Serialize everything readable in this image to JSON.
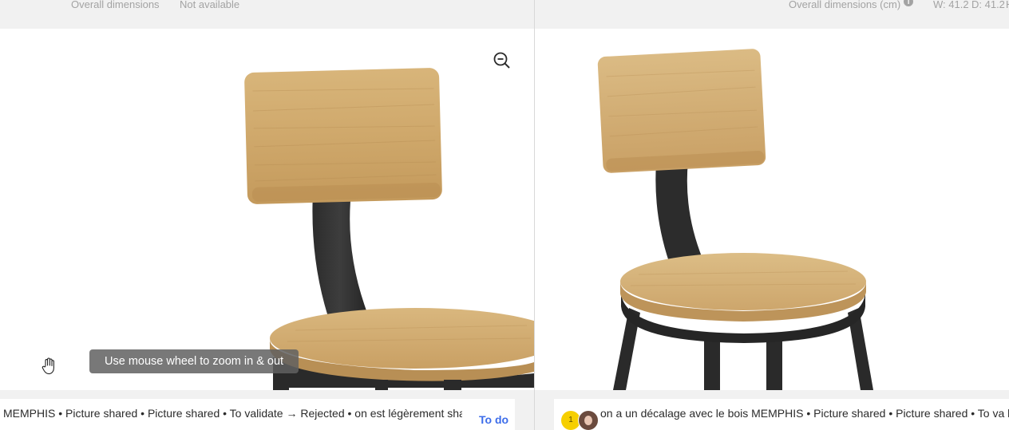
{
  "left_panel": {
    "dimensions_label": "Overall dimensions",
    "dimensions_value": "Not available",
    "zoom_hint": "Use mouse wheel to zoom in & out",
    "zoom_icon": "zoom-out-icon",
    "pan_icon": "hand-icon",
    "comment": {
      "text": "MEMPHIS • Picture shared • Picture shared • To validate → Rejected • on est légèrement shared • • To validate → Accepted • To validate → Accepted",
      "status_link": "To do"
    }
  },
  "right_panel": {
    "dimensions_label": "Overall dimensions (cm)",
    "info_icon": "info-icon",
    "width": "W: 41.2",
    "depth": "D: 41.2",
    "height": "H",
    "comment": {
      "badge_count": "1",
      "avatar_icon": "user-avatar",
      "text": "on a un décalage avec le bois MEMPHIS • Picture shared • Picture shared • To va légèrement trop clair maintenant • Picture shared • • To validate → Accepted • T"
    }
  },
  "colors": {
    "link": "#3d6dea",
    "badge": "#f6cf00",
    "dimension_text": "#a3a3a3",
    "panel_background": "#f1f1f1"
  }
}
